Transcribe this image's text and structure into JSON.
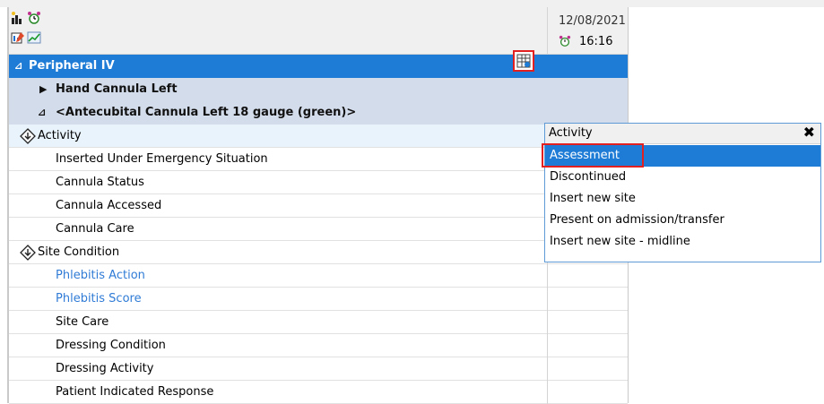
{
  "header": {
    "date": "12/08/2021",
    "time": "16:16"
  },
  "section": {
    "title": "Peripheral IV"
  },
  "subgroups": [
    {
      "label": "Hand Cannula Left"
    },
    {
      "label": "<Antecubital Cannula Left 18 gauge (green)>"
    }
  ],
  "rows": {
    "activity": "Activity",
    "inserted": "Inserted Under Emergency Situation",
    "status": "Cannula Status",
    "accessed": "Cannula Accessed",
    "care": "Cannula Care",
    "site_condition": "Site Condition",
    "phlebitis_action": "Phlebitis Action",
    "phlebitis_score": "Phlebitis Score",
    "site_care": "Site Care",
    "dressing_condition": "Dressing Condition",
    "dressing_activity": "Dressing Activity",
    "patient_response": "Patient Indicated Response"
  },
  "dropdown": {
    "title": "Activity",
    "close": "✖",
    "options": [
      "Assessment",
      "Discontinued",
      "Insert new site",
      "Present on admission/transfer",
      "Insert new site - midline"
    ],
    "selected": "Assessment"
  },
  "colors": {
    "section_bg": "#1e7bd6",
    "subgroup_bg": "#d3dcea",
    "highlight_box": "#e2201f",
    "link_text": "#2f7bd6"
  },
  "icons": [
    "chart-icon",
    "alarm-clock-icon",
    "pencil-chart-icon",
    "graph-icon",
    "grid-flowsheet-icon",
    "expand-diamond-icon"
  ]
}
